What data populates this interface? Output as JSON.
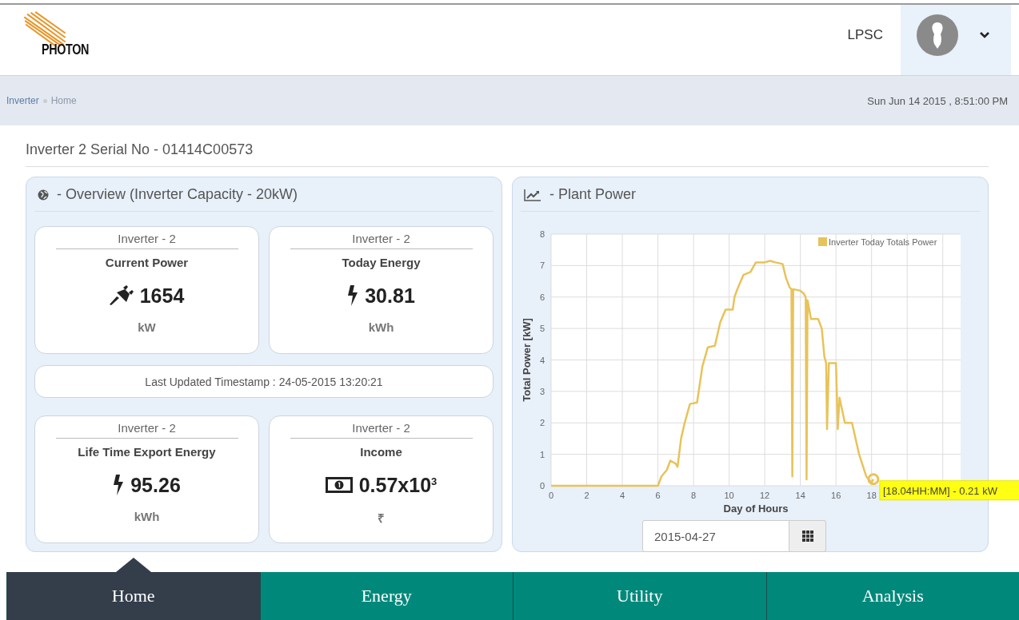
{
  "header": {
    "logo_text": "PHOTON",
    "user": "LPSC"
  },
  "breadcrumb": {
    "items": [
      {
        "label": "Inverter",
        "current": false
      },
      {
        "label": "Home",
        "current": true
      }
    ],
    "datetime": "Sun Jun 14 2015 , 8:51:00 PM"
  },
  "page_title": "Inverter 2 Serial No - 01414C00573",
  "overview": {
    "title": "- Overview (Inverter Capacity - 20kW)",
    "cards": [
      {
        "kind": "power",
        "header": "Inverter - 2",
        "title": "Current Power",
        "value": "1654",
        "unit": "kW"
      },
      {
        "kind": "energy",
        "header": "Inverter - 2",
        "title": "Today Energy",
        "value": "30.81",
        "unit": "kWh"
      }
    ],
    "timestamp": "Last Updated Timestamp : 24-05-2015 13:20:21",
    "cards_2": [
      {
        "kind": "energy",
        "header": "Inverter - 2",
        "title": "Life Time Export Energy",
        "value": "95.26",
        "unit": "kWh"
      },
      {
        "kind": "income",
        "header": "Inverter - 2",
        "title": "Income",
        "value": "0.57x10$^{3}$",
        "unit": "₹"
      }
    ]
  },
  "plant_power": {
    "title": "- Plant Power",
    "chart_data": {
      "type": "line",
      "xlabel": "Day of Hours",
      "ylabel": "Total Power [kW]",
      "grid": true,
      "xlim": [
        0,
        23
      ],
      "ylim": [
        0,
        8
      ],
      "xticks": [
        0,
        2,
        4,
        6,
        8,
        10,
        12,
        14,
        16,
        18
      ],
      "yticks": [
        0,
        1,
        2,
        3,
        4,
        5,
        6,
        7,
        8
      ],
      "x": [
        0,
        6,
        6.2,
        6.5,
        6.7,
        7,
        7.1,
        7.3,
        7.5,
        7.8,
        8.2,
        8.5,
        8.8,
        9.2,
        9.5,
        9.8,
        10.2,
        10.3,
        10.5,
        10.8,
        11.2,
        11.5,
        12,
        12.3,
        12.6,
        13,
        13.2,
        13.4,
        13.5,
        13.55,
        13.6,
        14,
        14.2,
        14.3,
        14.35,
        14.4,
        14.6,
        15,
        15.2,
        15.35,
        15.45,
        15.5,
        15.6,
        16,
        16.1,
        16.2,
        16.5,
        16.9,
        17.3,
        17.7,
        18,
        18.1
      ],
      "series": [
        {
          "name": "Inverter Today Totals Power",
          "color": "#e8c35a",
          "values": [
            0,
            0,
            0.3,
            0.5,
            0.8,
            0.7,
            0.6,
            1.5,
            2.0,
            2.6,
            2.65,
            3.8,
            4.4,
            4.45,
            5.2,
            5.6,
            5.6,
            6.0,
            6.3,
            6.7,
            6.8,
            7.1,
            7.1,
            7.15,
            7.1,
            7.05,
            6.6,
            6.3,
            6.25,
            0.3,
            6.25,
            6.2,
            6.1,
            6.0,
            0.2,
            5.9,
            5.3,
            5.3,
            5.0,
            4.1,
            3.9,
            1.8,
            3.9,
            3.9,
            1.8,
            2.8,
            2.0,
            2.0,
            1.0,
            0.3,
            0.1,
            0.21
          ]
        }
      ],
      "annotations": [
        {
          "x": 18.1,
          "y": 0.21,
          "text": "[18.04HH:MM] - 0.21 kW"
        }
      ]
    },
    "date_field": {
      "value": "2015-04-27"
    }
  },
  "nav": [
    {
      "label": "Home",
      "selected": true
    },
    {
      "label": "Energy",
      "selected": false
    },
    {
      "label": "Utility",
      "selected": false
    },
    {
      "label": "Analysis",
      "selected": false
    }
  ]
}
